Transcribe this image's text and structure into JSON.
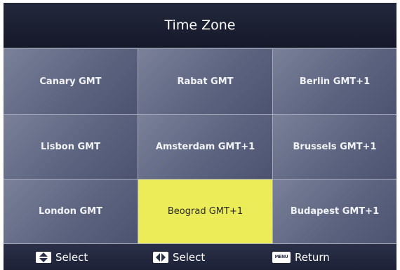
{
  "screen": {
    "title": "Time Zone"
  },
  "zones": [
    {
      "label": "Canary GMT",
      "selected": false
    },
    {
      "label": "Rabat GMT",
      "selected": false
    },
    {
      "label": "Berlin GMT+1",
      "selected": false
    },
    {
      "label": "Lisbon GMT",
      "selected": false
    },
    {
      "label": "Amsterdam GMT+1",
      "selected": false
    },
    {
      "label": "Brussels GMT+1",
      "selected": false
    },
    {
      "label": "London GMT",
      "selected": false
    },
    {
      "label": "Beograd GMT+1",
      "selected": true
    },
    {
      "label": "Budapest GMT+1",
      "selected": false
    }
  ],
  "footer": {
    "updown_icon": "up-down-arrow-icon",
    "updown_label": "Select",
    "leftright_icon": "left-right-arrow-icon",
    "leftright_label": "Select",
    "menu_icon": "menu-key-icon",
    "menu_key_text": "MENU",
    "return_label": "Return"
  },
  "colors": {
    "selected_background": "#ecec58",
    "cell_background": "#5c6480",
    "frame_background": "#161a2b"
  }
}
